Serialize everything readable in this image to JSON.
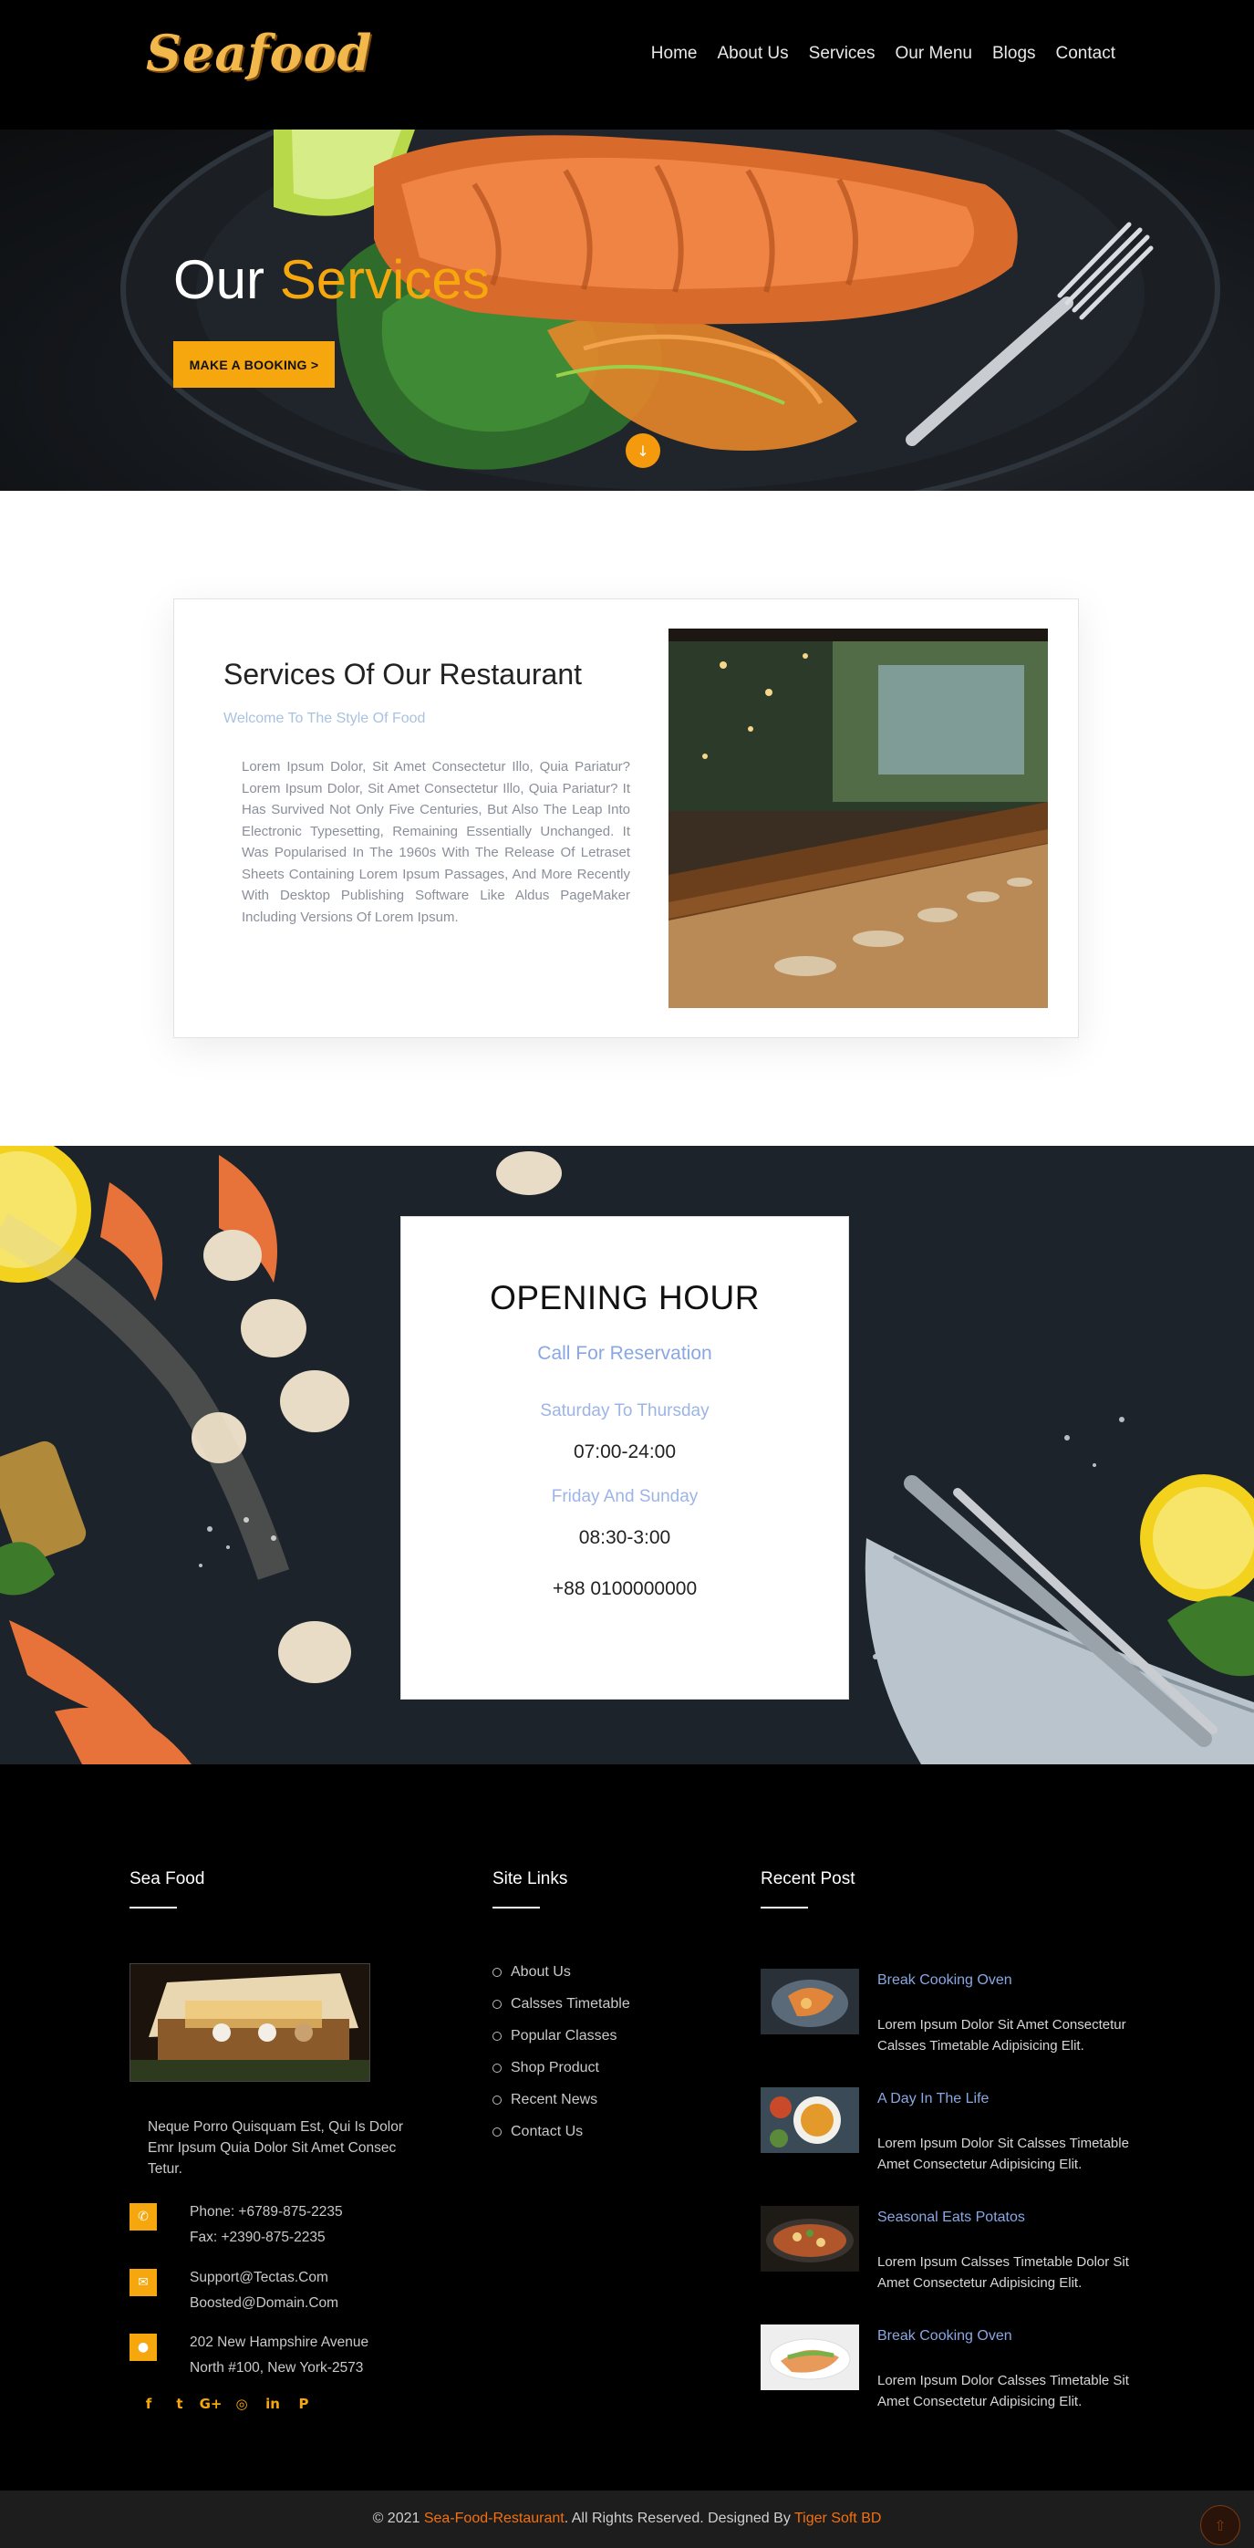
{
  "header": {
    "logo": "Seafood",
    "nav": [
      "Home",
      "About Us",
      "Services",
      "Our Menu",
      "Blogs",
      "Contact"
    ]
  },
  "hero": {
    "title_main": "Our",
    "title_accent": "Services",
    "button": "MAKE A BOOKING >"
  },
  "services": {
    "title": "Services Of Our Restaurant",
    "subtitle": "Welcome To The Style Of Food",
    "body": "Lorem Ipsum Dolor, Sit Amet Consectetur Illo, Quia Pariatur? Lorem Ipsum Dolor, Sit Amet Consectetur Illo, Quia Pariatur? It Has Survived Not Only Five Centuries, But Also The Leap Into Electronic Typesetting, Remaining Essentially Unchanged. It Was Popularised In The 1960s With The Release Of Letraset Sheets Containing Lorem Ipsum Passages, And More Recently With Desktop Publishing Software Like Aldus PageMaker Including Versions Of Lorem Ipsum."
  },
  "hours": {
    "title": "OPENING HOUR",
    "call": "Call For Reservation",
    "day1": "Saturday To Thursday",
    "time1": "07:00-24:00",
    "day2": "Friday And Sunday",
    "time2": "08:30-3:00",
    "phone": "+88 0100000000"
  },
  "footer": {
    "col1_title": "Sea Food",
    "about": "Neque Porro Quisquam Est, Qui Is Dolor Emr Ipsum Quia Dolor Sit Amet Consec Tetur.",
    "phone": "Phone: +6789-875-2235",
    "fax": "Fax: +2390-875-2235",
    "email1": "Support@Tectas.Com",
    "email2": "Boosted@Domain.Com",
    "addr1": "202 New Hampshire Avenue",
    "addr2": "North #100, New York-2573",
    "col2_title": "Site Links",
    "links": [
      "About Us",
      "Calsses Timetable",
      "Popular Classes",
      "Shop Product",
      "Recent News",
      "Contact Us"
    ],
    "col3_title": "Recent Post",
    "posts": [
      {
        "title": "Break Cooking Oven",
        "text": "Lorem Ipsum Dolor Sit Amet Consectetur Calsses Timetable Adipisicing Elit."
      },
      {
        "title": "A Day In The Life",
        "text": "Lorem Ipsum Dolor Sit Calsses Timetable Amet Consectetur Adipisicing Elit."
      },
      {
        "title": "Seasonal Eats Potatos",
        "text": "Lorem Ipsum Calsses Timetable Dolor Sit Amet Consectetur Adipisicing Elit."
      },
      {
        "title": "Break Cooking Oven",
        "text": "Lorem Ipsum Dolor Calsses Timetable Sit Amet Consectetur Adipisicing Elit."
      }
    ]
  },
  "copyright": {
    "prefix": "© 2021 ",
    "site": "Sea-Food-Restaurant",
    "middle": ". All Rights Reserved. Designed By ",
    "designer": "Tiger Soft BD"
  },
  "colors": {
    "accent": "#f5a70d",
    "link_blue": "#89a7e2",
    "footer_bg": "#000000"
  },
  "icons": [
    "chevron-down-icon",
    "phone-icon",
    "mail-icon",
    "location-icon",
    "facebook-icon",
    "twitter-icon",
    "google-plus-icon",
    "dribbble-icon",
    "linkedin-icon",
    "pinterest-icon",
    "arrow-up-icon"
  ]
}
